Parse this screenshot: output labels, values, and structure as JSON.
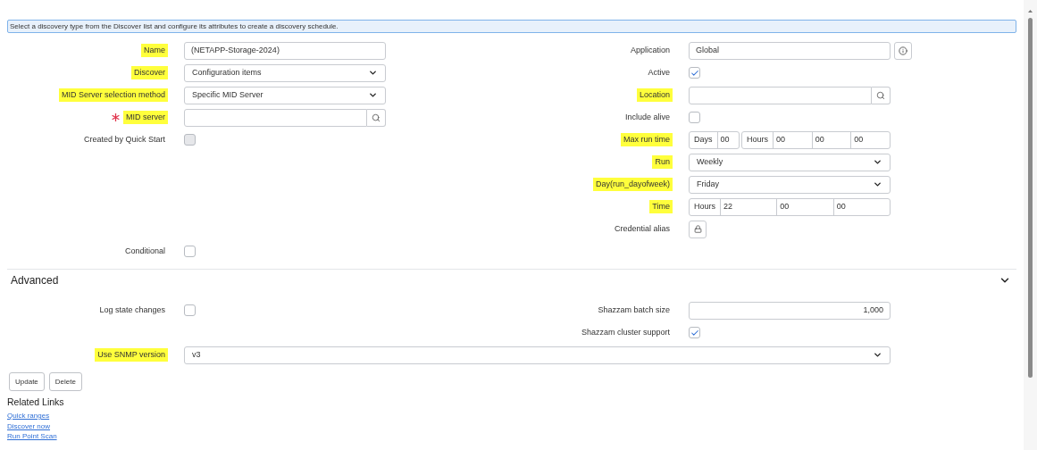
{
  "info_banner": "Select a discovery type from the Discover list and configure its attributes to create a discovery schedule.",
  "left_fields": [
    {
      "label": "Name",
      "highlighted": true,
      "required": false,
      "kind": "text",
      "value": "(NETAPP-Storage-2024)"
    },
    {
      "label": "Discover",
      "highlighted": true,
      "required": false,
      "kind": "select",
      "value": "Configuration items"
    },
    {
      "label": "MID Server selection method",
      "highlighted": true,
      "required": false,
      "kind": "select",
      "value": "Specific MID Server"
    },
    {
      "label": "MID server",
      "highlighted": true,
      "required": true,
      "kind": "reference"
    },
    {
      "label": "Created by Quick Start",
      "highlighted": false,
      "required": false,
      "kind": "checkbox",
      "checked": false,
      "disabled": true
    }
  ],
  "right_fields": [
    {
      "label": "Application",
      "highlighted": false,
      "required": false,
      "kind": "readonly",
      "value": "Global"
    },
    {
      "label": "Active",
      "highlighted": false,
      "required": false,
      "kind": "checkbox",
      "checked": true,
      "disabled": false
    },
    {
      "label": "Location",
      "highlighted": true,
      "required": false,
      "kind": "reference"
    },
    {
      "label": "Include alive",
      "highlighted": false,
      "required": false,
      "kind": "checkbox",
      "checked": false,
      "disabled": false
    },
    {
      "label": "Max run time",
      "highlighted": true,
      "required": false,
      "kind": "duration",
      "groups": [
        {
          "unit": "Days",
          "values": [
            "00"
          ]
        },
        {
          "unit": "Hours",
          "values": [
            "00",
            "00",
            "00"
          ]
        }
      ]
    },
    {
      "label": "Run",
      "highlighted": true,
      "required": false,
      "kind": "select",
      "value": "Weekly"
    },
    {
      "label": "Day(run_dayofweek)",
      "highlighted": true,
      "required": false,
      "kind": "select",
      "value": "Friday"
    },
    {
      "label": "Time",
      "highlighted": true,
      "required": false,
      "kind": "duration",
      "groups": [
        {
          "unit": "Hours",
          "values": [
            "22",
            "00",
            "00"
          ]
        }
      ]
    },
    {
      "label": "Credential alias",
      "highlighted": false,
      "required": false,
      "kind": "lock"
    }
  ],
  "conditional": {
    "label": "Conditional",
    "highlighted": false,
    "required": false,
    "kind": "checkbox",
    "checked": false,
    "disabled": false
  },
  "advanced": {
    "title": "Advanced",
    "expanded": true,
    "left_fields": [
      {
        "label": "Log state changes",
        "highlighted": false,
        "required": false,
        "kind": "checkbox",
        "checked": false,
        "disabled": false
      }
    ],
    "right_fields": [
      {
        "label": "Shazzam batch size",
        "highlighted": false,
        "required": false,
        "kind": "number",
        "value": "1,000"
      },
      {
        "label": "Shazzam cluster support",
        "highlighted": false,
        "required": false,
        "kind": "checkbox",
        "checked": true,
        "disabled": false
      }
    ],
    "wide_fields": [
      {
        "label": "Use SNMP version",
        "highlighted": true,
        "required": false,
        "kind": "select",
        "value": "v3"
      }
    ]
  },
  "buttons": [
    "Update",
    "Delete"
  ],
  "related_links": {
    "title": "Related Links",
    "links": [
      "Quick ranges",
      "Discover now",
      "Run Point Scan"
    ]
  }
}
